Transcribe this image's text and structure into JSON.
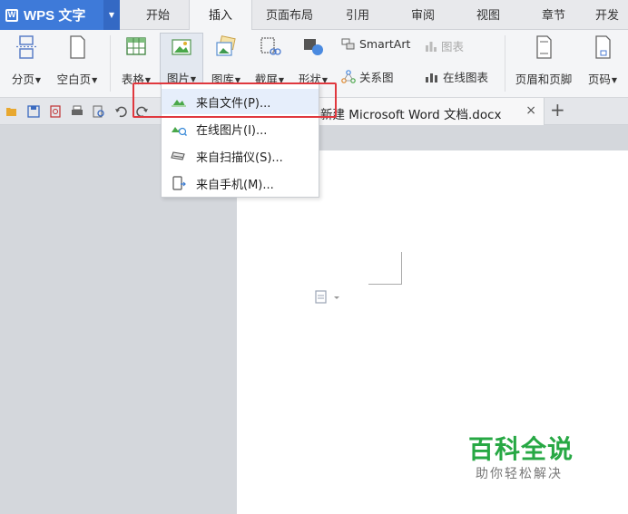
{
  "app": {
    "name": "WPS 文字",
    "icon": "wps-writer-icon",
    "accent_color": "#3e7ad9"
  },
  "tabs": [
    {
      "label": "开始"
    },
    {
      "label": "插入",
      "active": true
    },
    {
      "label": "页面布局"
    },
    {
      "label": "引用"
    },
    {
      "label": "审阅"
    },
    {
      "label": "视图"
    },
    {
      "label": "章节"
    },
    {
      "label": "开发"
    }
  ],
  "ribbon": {
    "page_break": "分页",
    "blank_page": "空白页",
    "table": "表格",
    "picture": "图片",
    "gallery": "图库",
    "screenshot": "截屏",
    "shape": "形状",
    "smartart": "SmartArt",
    "chart": "图表",
    "relation_chart": "关系图",
    "online_chart": "在线图表",
    "header_footer": "页眉和页脚",
    "page_number": "页码"
  },
  "document_tab": {
    "title": "新建 Microsoft Word 文档.docx",
    "close": "×",
    "new_tab": "+"
  },
  "picture_menu": {
    "items": [
      {
        "label": "来自文件(P)...",
        "icon": "image-file-icon",
        "highlighted": true
      },
      {
        "label": "在线图片(I)...",
        "icon": "online-image-icon"
      },
      {
        "label": "来自扫描仪(S)...",
        "icon": "scanner-icon"
      },
      {
        "label": "来自手机(M)...",
        "icon": "phone-icon"
      }
    ]
  },
  "watermark": {
    "title": "百科全说",
    "subtitle": "助你轻松解决",
    "color": "#27a844"
  }
}
